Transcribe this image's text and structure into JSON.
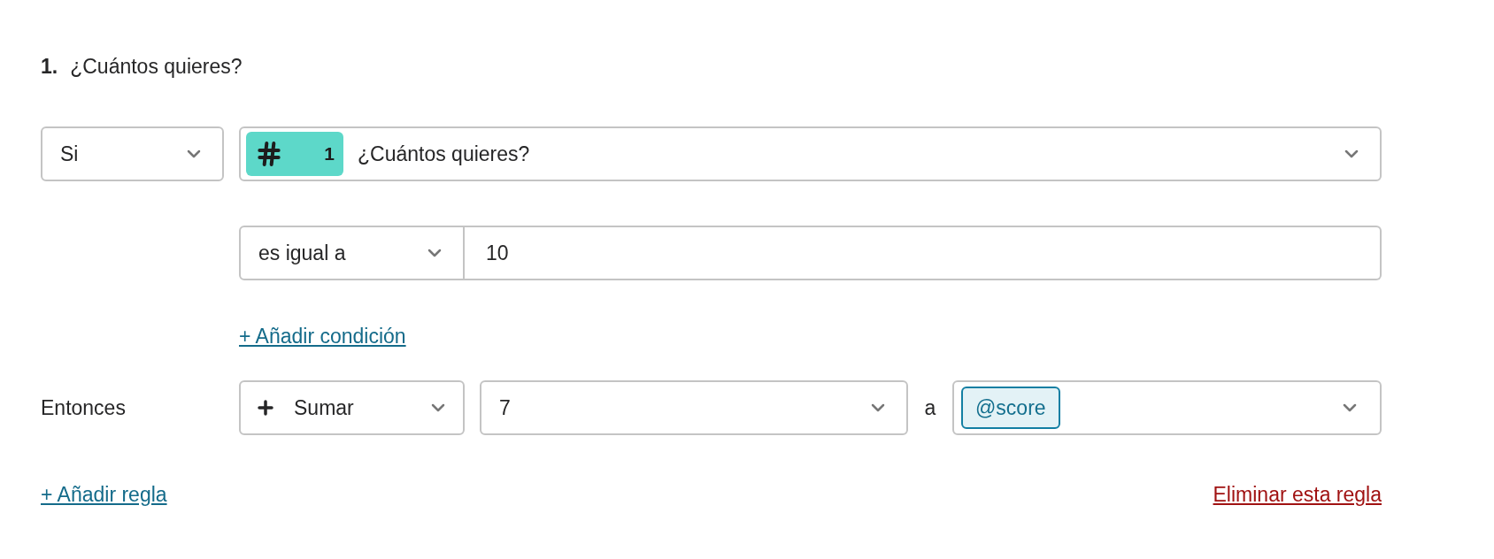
{
  "question": {
    "number": "1.",
    "title": "¿Cuántos quieres?"
  },
  "condition": {
    "connector": "Si",
    "question_badge": "1",
    "question": "¿Cuántos quieres?",
    "operator": "es igual a",
    "value": "10",
    "add_condition": "+ Añadir condición"
  },
  "action": {
    "label": "Entonces",
    "operation": "Sumar",
    "amount": "7",
    "preposition": "a",
    "variable": "@score"
  },
  "footer": {
    "add_rule": "+ Añadir regla",
    "delete_rule": "Eliminar esta regla"
  }
}
